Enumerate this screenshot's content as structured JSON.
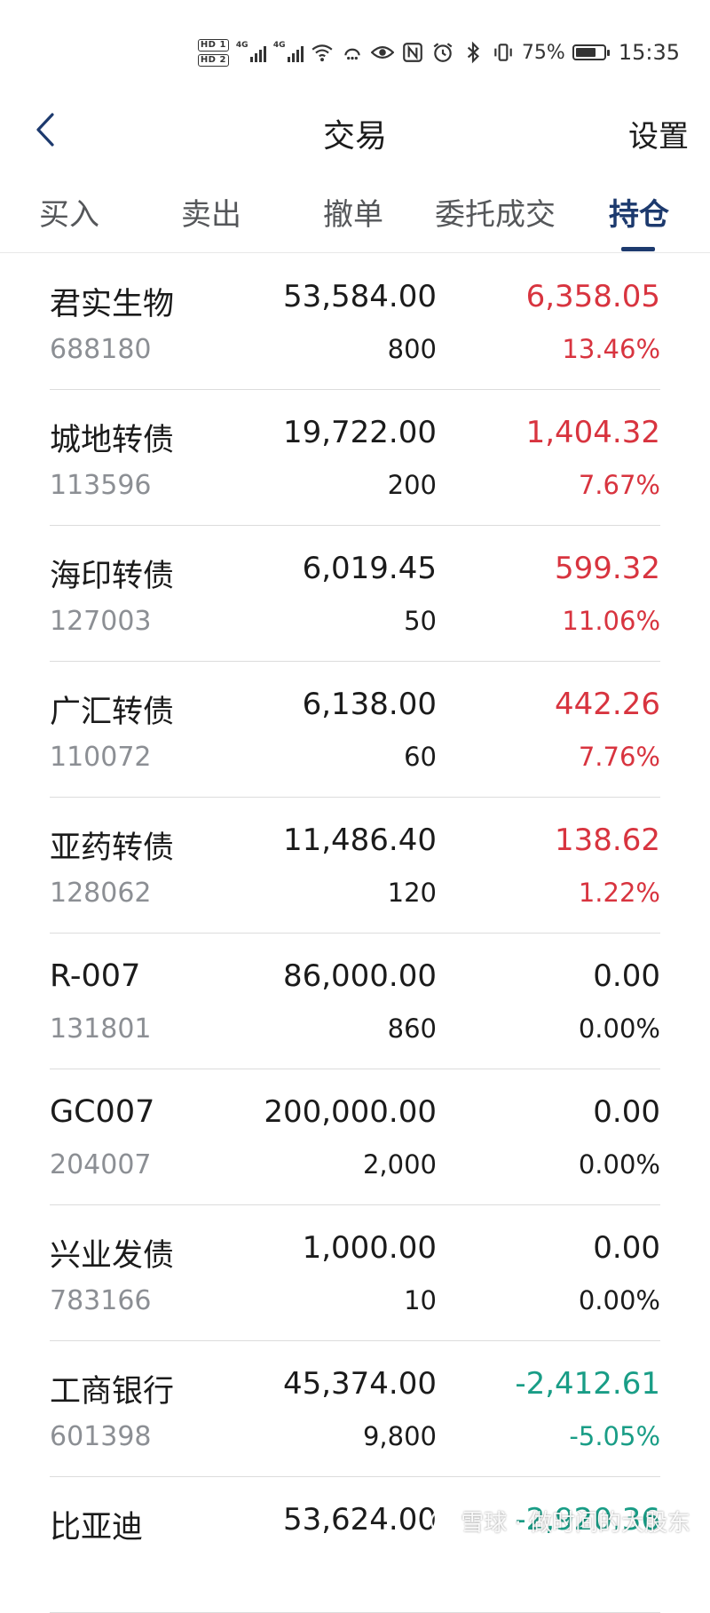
{
  "status_bar": {
    "sim_labels": [
      "HD 1",
      "HD 2"
    ],
    "network_labels": [
      "4G",
      "4G"
    ],
    "icons": [
      "wifi-icon",
      "hotspot-icon",
      "eye-icon",
      "nfc-icon",
      "alarm-icon",
      "bluetooth-icon",
      "vibrate-icon"
    ],
    "battery_level": 0.75,
    "battery_text": "75%",
    "time": "15:35"
  },
  "header": {
    "title": "交易",
    "settings_label": "设置"
  },
  "tabs": [
    {
      "label": "买入"
    },
    {
      "label": "卖出"
    },
    {
      "label": "撤单"
    },
    {
      "label": "委托成交"
    },
    {
      "label": "持仓",
      "active": true
    }
  ],
  "holdings": [
    {
      "name": "君实生物",
      "code": "688180",
      "value": "53,584.00",
      "qty": "800",
      "pnl": "6,358.05",
      "pct": "13.46%",
      "trend": "up"
    },
    {
      "name": "城地转债",
      "code": "113596",
      "value": "19,722.00",
      "qty": "200",
      "pnl": "1,404.32",
      "pct": "7.67%",
      "trend": "up"
    },
    {
      "name": "海印转债",
      "code": "127003",
      "value": "6,019.45",
      "qty": "50",
      "pnl": "599.32",
      "pct": "11.06%",
      "trend": "up"
    },
    {
      "name": "广汇转债",
      "code": "110072",
      "value": "6,138.00",
      "qty": "60",
      "pnl": "442.26",
      "pct": "7.76%",
      "trend": "up"
    },
    {
      "name": "亚药转债",
      "code": "128062",
      "value": "11,486.40",
      "qty": "120",
      "pnl": "138.62",
      "pct": "1.22%",
      "trend": "up"
    },
    {
      "name": " R-007",
      "code": "131801",
      "value": "86,000.00",
      "qty": "860",
      "pnl": "0.00",
      "pct": "0.00%",
      "trend": "flat"
    },
    {
      "name": " GC007",
      "code": "204007",
      "value": "200,000.00",
      "qty": "2,000",
      "pnl": "0.00",
      "pct": "0.00%",
      "trend": "flat"
    },
    {
      "name": "兴业发债",
      "code": "783166",
      "value": "1,000.00",
      "qty": "10",
      "pnl": "0.00",
      "pct": "0.00%",
      "trend": "flat"
    },
    {
      "name": "工商银行",
      "code": "601398",
      "value": "45,374.00",
      "qty": "9,800",
      "pnl": "-2,412.61",
      "pct": "-5.05%",
      "trend": "down"
    },
    {
      "name": "比亚迪",
      "code": "",
      "value": "53,624.00",
      "qty": "",
      "pnl": "-2,920.36",
      "pct": "",
      "trend": "down"
    }
  ],
  "colors": {
    "up": "#d8343f",
    "down": "#199d86",
    "flat": "#1b1b1b",
    "accent": "#1d3a6e"
  },
  "watermark": "雪球 · 做时间的大股东"
}
